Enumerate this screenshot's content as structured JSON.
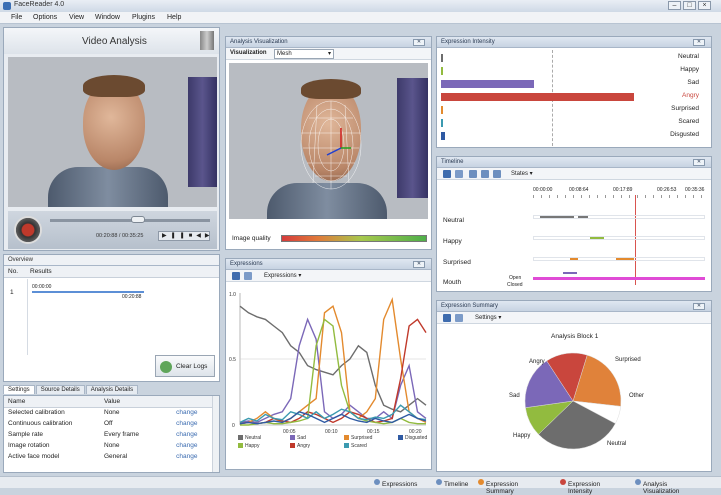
{
  "window": {
    "title": "FaceReader 4.0"
  },
  "menu": [
    "File",
    "Options",
    "View",
    "Window",
    "Plugins",
    "Help"
  ],
  "video_panel": {
    "title": "Video Analysis",
    "time": "00:20:88 / 00:35:25",
    "progress": 0.55
  },
  "overview": {
    "title": "Overview",
    "columns": [
      "No.",
      "Results"
    ],
    "row_no": "1",
    "start": "00:00:00",
    "end": "00:20:88",
    "clear_logs": "Clear Logs"
  },
  "settings_tabs": [
    "Settings",
    "Source Details",
    "Analysis Details"
  ],
  "settings": {
    "columns": [
      "Name",
      "Value"
    ],
    "rows": [
      {
        "name": "Selected calibration",
        "value": "None",
        "action": "change"
      },
      {
        "name": "Continuous calibration",
        "value": "Off",
        "action": "change"
      },
      {
        "name": "Sample rate",
        "value": "Every frame",
        "action": "change"
      },
      {
        "name": "Image rotation",
        "value": "None",
        "action": "change"
      },
      {
        "name": "Active face model",
        "value": "General",
        "action": "change"
      }
    ]
  },
  "analysis_vis": {
    "title": "Analysis Visualization",
    "label": "Visualization",
    "value": "Mesh",
    "quality_label": "Image quality"
  },
  "expressions_panel": {
    "title": "Expressions",
    "menu": "Expressions",
    "y_ticks": [
      "1.0",
      "0.5",
      "0"
    ],
    "x_ticks": [
      "00:05",
      "00:10",
      "00:15",
      "00:20"
    ],
    "legend": [
      {
        "name": "Neutral",
        "color": "#6d6d6d"
      },
      {
        "name": "Sad",
        "color": "#7b68b8"
      },
      {
        "name": "Surprised",
        "color": "#e38a2e"
      },
      {
        "name": "Disgusted",
        "color": "#2f5aa3"
      },
      {
        "name": "Happy",
        "color": "#92bb3f"
      },
      {
        "name": "Angry",
        "color": "#c0392b"
      },
      {
        "name": "Scared",
        "color": "#3b9ab0"
      }
    ]
  },
  "intensity_panel": {
    "title": "Expression Intensity",
    "items": [
      {
        "label": "Neutral",
        "value": 0.0,
        "color": "#6d6d6d"
      },
      {
        "label": "Happy",
        "value": 0.0,
        "color": "#92bb3f"
      },
      {
        "label": "Sad",
        "value": 0.48,
        "color": "#7b68b8"
      },
      {
        "label": "Angry",
        "value": 1.0,
        "color": "#c9463d"
      },
      {
        "label": "Surprised",
        "value": 0.01,
        "color": "#e38a2e"
      },
      {
        "label": "Scared",
        "value": 0.0,
        "color": "#3b9ab0"
      },
      {
        "label": "Disgusted",
        "value": 0.02,
        "color": "#2f5aa3"
      }
    ],
    "angry_label_color": "#c9463d"
  },
  "timeline_panel": {
    "title": "Timeline",
    "menu": "States",
    "ticks": [
      "00:00:00",
      "00:08:64",
      "00:17:89",
      "00:26:53",
      "00:35:36"
    ],
    "rows": [
      "Neutral",
      "Happy",
      "Surprised",
      "Mouth"
    ],
    "mouth_states": [
      "Open",
      "Closed"
    ]
  },
  "summary_panel": {
    "title": "Expression Summary",
    "menu": "Settings",
    "chart_title": "Analysis Block 1",
    "labels": [
      "Surprised",
      "Angry",
      "Sad",
      "Happy",
      "Neutral",
      "Other"
    ]
  },
  "chart_data": [
    {
      "type": "line",
      "title": "",
      "x": [
        0,
        1,
        2,
        3,
        4,
        5,
        6,
        7,
        8,
        9,
        10,
        11,
        12,
        13,
        14,
        15,
        16,
        17,
        18,
        19,
        20,
        21,
        22
      ],
      "ylim": [
        0,
        1
      ],
      "series": [
        {
          "name": "Neutral",
          "color": "#6d6d6d",
          "values": [
            0.9,
            0.85,
            0.82,
            0.8,
            0.75,
            0.7,
            0.6,
            0.55,
            0.45,
            0.42,
            0.4,
            0.38,
            0.45,
            0.5,
            0.6,
            0.55,
            0.3,
            0.15,
            0.12,
            0.1,
            0.15,
            0.2,
            0.15
          ]
        },
        {
          "name": "Sad",
          "color": "#7b68b8",
          "values": [
            0.02,
            0.03,
            0.02,
            0.05,
            0.08,
            0.1,
            0.2,
            0.6,
            0.8,
            0.65,
            0.1,
            0.05,
            0.08,
            0.15,
            0.1,
            0.05,
            0.05,
            0.1,
            0.05,
            0.3,
            0.45,
            0.1,
            0.05
          ]
        },
        {
          "name": "Surprised",
          "color": "#e38a2e",
          "values": [
            0.01,
            0.02,
            0.05,
            0.1,
            0.05,
            0.02,
            0.05,
            0.1,
            0.15,
            0.2,
            0.85,
            0.9,
            0.7,
            0.1,
            0.05,
            0.1,
            0.2,
            0.8,
            0.95,
            0.5,
            0.1,
            0.05,
            0.02
          ]
        },
        {
          "name": "Angry",
          "color": "#c0392b",
          "values": [
            0.01,
            0.02,
            0.01,
            0.02,
            0.05,
            0.03,
            0.02,
            0.05,
            0.1,
            0.08,
            0.05,
            0.02,
            0.05,
            0.1,
            0.08,
            0.05,
            0.02,
            0.03,
            0.05,
            0.35,
            0.75,
            0.8,
            0.7
          ]
        },
        {
          "name": "Happy",
          "color": "#92bb3f",
          "values": [
            0.0,
            0.0,
            0.01,
            0.02,
            0.01,
            0.01,
            0.02,
            0.03,
            0.05,
            0.6,
            0.8,
            0.75,
            0.3,
            0.1,
            0.05,
            0.03,
            0.02,
            0.01,
            0.02,
            0.05,
            0.02,
            0.01,
            0.01
          ]
        },
        {
          "name": "Scared",
          "color": "#3b9ab0",
          "values": [
            0.02,
            0.05,
            0.03,
            0.08,
            0.05,
            0.04,
            0.1,
            0.08,
            0.05,
            0.1,
            0.05,
            0.08,
            0.12,
            0.1,
            0.05,
            0.04,
            0.06,
            0.05,
            0.08,
            0.15,
            0.1,
            0.05,
            0.04
          ]
        },
        {
          "name": "Disgusted",
          "color": "#2f5aa3",
          "values": [
            0.01,
            0.02,
            0.01,
            0.02,
            0.03,
            0.02,
            0.05,
            0.1,
            0.08,
            0.05,
            0.02,
            0.05,
            0.08,
            0.05,
            0.03,
            0.02,
            0.05,
            0.03,
            0.02,
            0.05,
            0.08,
            0.05,
            0.03
          ]
        }
      ]
    },
    {
      "type": "pie",
      "title": "Analysis Block 1",
      "categories": [
        "Surprised",
        "Other",
        "Neutral",
        "Happy",
        "Sad",
        "Angry"
      ],
      "values": [
        22,
        6,
        30,
        10,
        18,
        14
      ],
      "colors": [
        "#e0823a",
        "#ffffff",
        "#6d6d6d",
        "#92bb3f",
        "#7b68b8",
        "#c9463d"
      ]
    }
  ]
}
